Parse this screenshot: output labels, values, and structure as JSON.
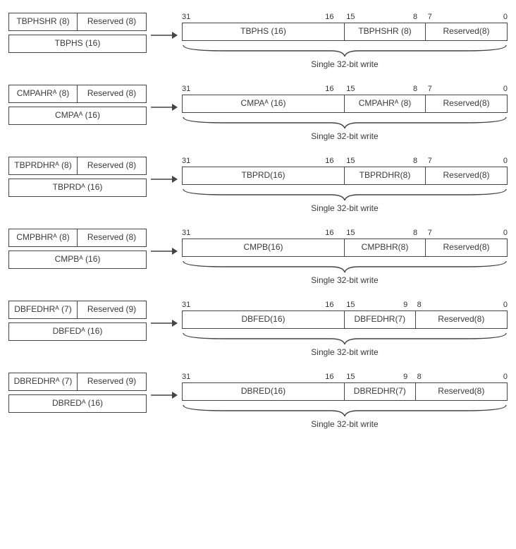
{
  "caption": "Single 32-bit write",
  "rows": [
    {
      "srcTopL": "TBPHSHR (8)",
      "srcTopR": "Reserved (8)",
      "srcBot": "TBPHS (16)",
      "bits": {
        "hi": "31",
        "midR": "16",
        "midL": "15",
        "bR": "8",
        "bL": "7",
        "lo": "0"
      },
      "f1": "TBPHS (16)",
      "f2": "TBPHSHR (8)",
      "f3": "Reserved(8)",
      "variant": "8"
    },
    {
      "srcTopL": "CMPAHRᴬ (8)",
      "srcTopR": "Reserved (8)",
      "srcBot": "CMPAᴬ (16)",
      "bits": {
        "hi": "31",
        "midR": "16",
        "midL": "15",
        "bR": "8",
        "bL": "7",
        "lo": "0"
      },
      "f1": "CMPAᴬ (16)",
      "f2": "CMPAHRᴬ (8)",
      "f3": "Reserved(8)",
      "variant": "8"
    },
    {
      "srcTopL": "TBPRDHRᴬ (8)",
      "srcTopR": "Reserved (8)",
      "srcBot": "TBPRDᴬ (16)",
      "bits": {
        "hi": "31",
        "midR": "16",
        "midL": "15",
        "bR": "8",
        "bL": "7",
        "lo": "0"
      },
      "f1": "TBPRD(16)",
      "f2": "TBPRDHR(8)",
      "f3": "Reserved(8)",
      "variant": "8"
    },
    {
      "srcTopL": "CMPBHRᴬ (8)",
      "srcTopR": "Reserved (8)",
      "srcBot": "CMPBᴬ (16)",
      "bits": {
        "hi": "31",
        "midR": "16",
        "midL": "15",
        "bR": "8",
        "bL": "7",
        "lo": "0"
      },
      "f1": "CMPB(16)",
      "f2": "CMPBHR(8)",
      "f3": "Reserved(8)",
      "variant": "8"
    },
    {
      "srcTopL": "DBFEDHRᴬ (7)",
      "srcTopR": "Reserved (9)",
      "srcBot": "DBFEDᴬ (16)",
      "bits": {
        "hi": "31",
        "midR": "16",
        "midL": "15",
        "bR": "9",
        "bL": "8",
        "lo": "0"
      },
      "f1": "DBFED(16)",
      "f2": "DBFEDHR(7)",
      "f3": "Reserved(8)",
      "variant": "9"
    },
    {
      "srcTopL": "DBREDHRᴬ (7)",
      "srcTopR": "Reserved (9)",
      "srcBot": "DBREDᴬ (16)",
      "bits": {
        "hi": "31",
        "midR": "16",
        "midL": "15",
        "bR": "9",
        "bL": "8",
        "lo": "0"
      },
      "f1": "DBRED(16)",
      "f2": "DBREDHR(7)",
      "f3": "Reserved(8)",
      "variant": "9"
    }
  ]
}
